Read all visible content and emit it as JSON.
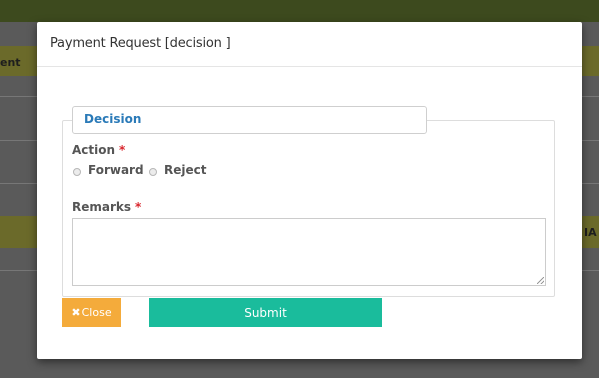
{
  "background_page": {
    "left_fragment_top": "ent",
    "right_fragment": "IA"
  },
  "modal": {
    "title": "Payment Request [decision ]",
    "section_legend": "Decision",
    "action": {
      "label": "Action",
      "required_mark": "*",
      "options": [
        "Forward",
        "Reject"
      ],
      "selected": null
    },
    "remarks": {
      "label": "Remarks",
      "required_mark": "*",
      "value": ""
    },
    "buttons": {
      "close_icon": "x-icon",
      "close_label": "Close",
      "submit_label": "Submit"
    }
  },
  "colors": {
    "legend_text": "#2a7ab8",
    "required": "#d9262d",
    "close_button": "#f4ab3b",
    "submit_button": "#1abc9c"
  }
}
